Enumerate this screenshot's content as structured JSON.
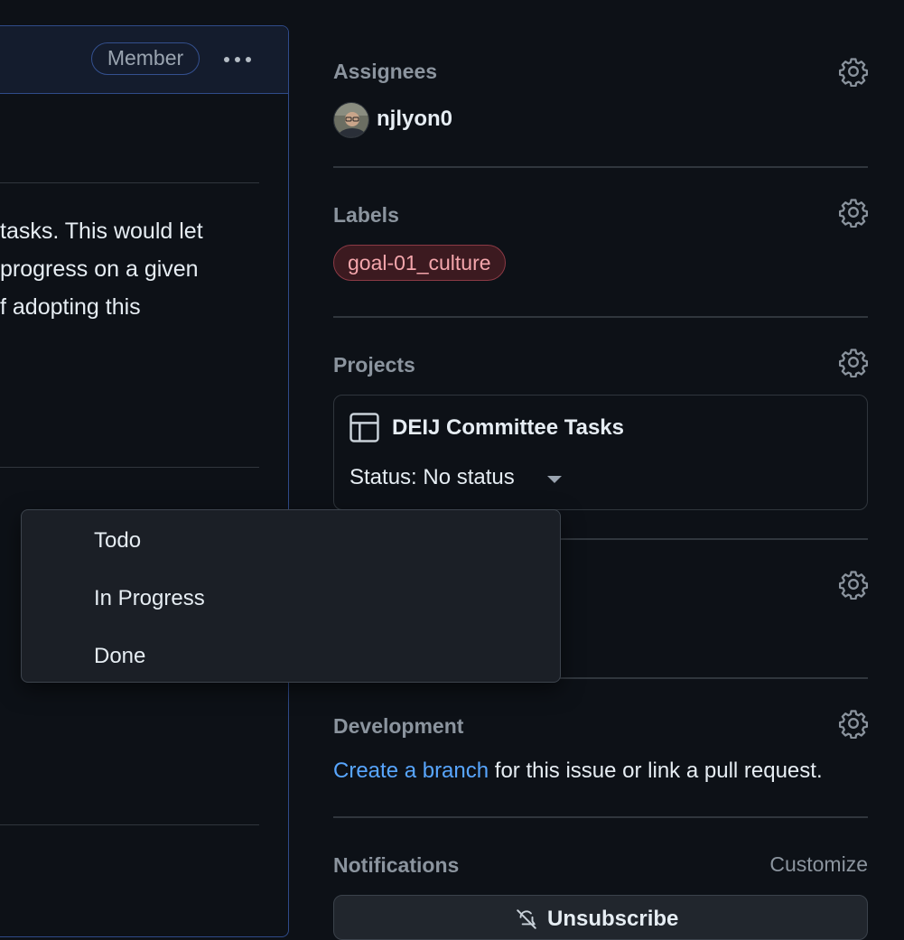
{
  "comment": {
    "badge": "Member",
    "body_lines": [
      "tasks. This would let",
      "progress on a given",
      "f adopting this"
    ]
  },
  "sidebar": {
    "assignees": {
      "title": "Assignees",
      "user": "njlyon0",
      "icon": "gear-icon"
    },
    "labels": {
      "title": "Labels",
      "items": [
        {
          "name": "goal-01_culture",
          "color": "#f4a6ac"
        }
      ]
    },
    "projects": {
      "title": "Projects",
      "project_name": "DEIJ Committee Tasks",
      "status": "Status: No status"
    },
    "development": {
      "title": "Development",
      "link_text": "Create a branch",
      "rest_text": " for this issue or link a pull request."
    },
    "notifications": {
      "title": "Notifications",
      "customize": "Customize",
      "button_label": "Unsubscribe"
    }
  },
  "status_dropdown": {
    "options": [
      "Todo",
      "In Progress",
      "Done"
    ]
  },
  "colors": {
    "background": "#0d1117",
    "accent_link": "#58a6ff",
    "member_border": "#34508f",
    "label_bg": "#3c1a20"
  }
}
